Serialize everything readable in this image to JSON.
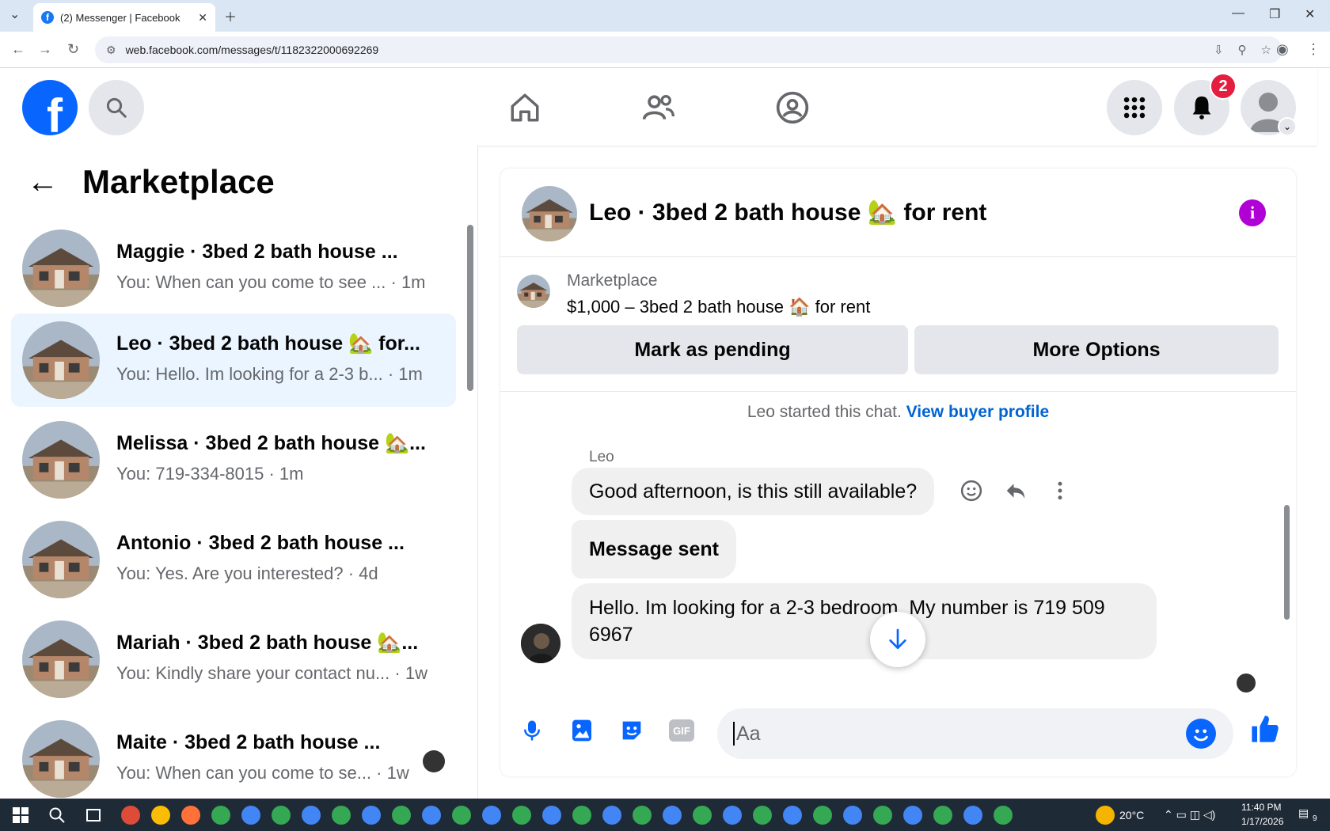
{
  "browser": {
    "tab_title": "(2) Messenger | Facebook",
    "url": "web.facebook.com/messages/t/1182322000692269"
  },
  "header": {
    "notification_count": "2"
  },
  "sidebar": {
    "title": "Marketplace",
    "conversations": [
      {
        "name": "Maggie · 3bed 2 bath house ...",
        "snippet": "You: When can you come to see ... · 1m"
      },
      {
        "name": "Leo · 3bed 2 bath house 🏡 for...",
        "snippet": "You: Hello. Im looking for a 2-3 b... · 1m"
      },
      {
        "name": "Melissa · 3bed 2 bath house 🏡...",
        "snippet": "You: 719-334-8015 · 1m"
      },
      {
        "name": "Antonio · 3bed 2 bath house ...",
        "snippet": "You: Yes. Are you interested? · 4d"
      },
      {
        "name": "Mariah · 3bed 2 bath house 🏡...",
        "snippet": "You: Kindly share your contact nu... · 1w"
      },
      {
        "name": "Maite · 3bed 2 bath house ...",
        "snippet": "You: When can you come to se... · 1w"
      }
    ]
  },
  "chat": {
    "title": "Leo · 3bed 2 bath house 🏡 for rent",
    "marketplace_label": "Marketplace",
    "listing": "$1,000 – 3bed 2 bath house 🏠 for rent",
    "mark_pending": "Mark as pending",
    "more_options": "More Options",
    "started_text": "Leo started this chat.",
    "view_profile": "View buyer profile",
    "sender": "Leo",
    "messages": [
      "Good afternoon, is this still available?",
      "Message sent",
      "Hello. Im looking for a 2-3 bedroom. My number is 719 509 6967"
    ],
    "composer_placeholder": "Aa"
  },
  "taskbar": {
    "weather": "20°C",
    "time": "11:40 PM",
    "date": "1/17/2026",
    "notif_count": "9"
  }
}
